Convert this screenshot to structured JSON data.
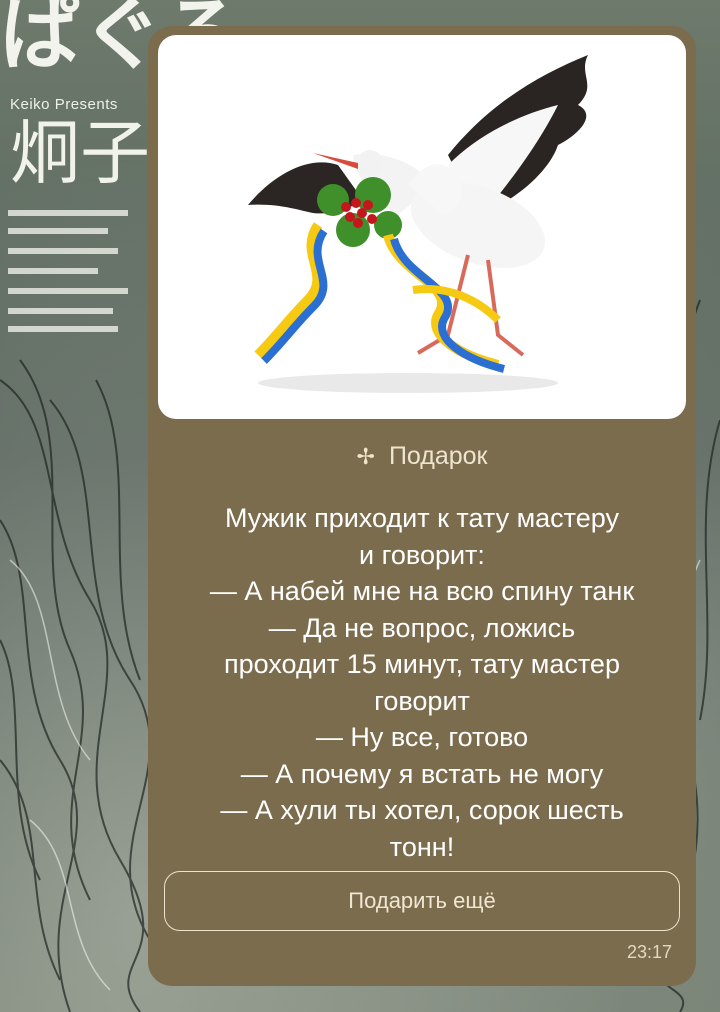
{
  "wallpaper": {
    "title": "Keiko Presents",
    "kanji": "炯子",
    "top_text": "ぱぐる"
  },
  "message": {
    "gift_icon": "gift-icon",
    "gift_label": "Подарок",
    "joke_lines": [
      "Мужик приходит к тату мастеру",
      "и говорит:",
      "— А набей мне на всю спину танк",
      "— Да не вопрос, ложись",
      "проходит 15 минут, тату мастер",
      "говорит",
      "— Ну все, готово",
      "— А почему я встать не могу",
      "— А хули ты хотел, сорок шесть",
      "тонн!"
    ],
    "button_label": "Подарить ещё",
    "time": "23:17"
  },
  "colors": {
    "bubble": "#7c6c4e",
    "text": "#ffffff",
    "accent": "#ede5cf"
  }
}
